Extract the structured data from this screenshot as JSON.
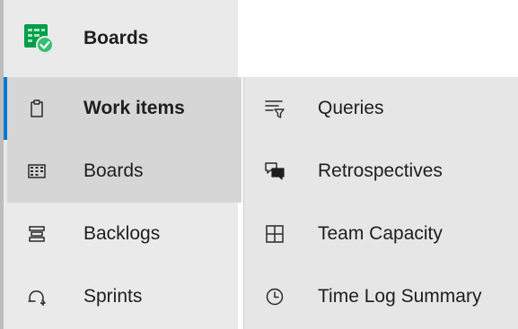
{
  "nav": {
    "header": {
      "label": "Boards",
      "icon": "boards-app-icon"
    },
    "items": [
      {
        "label": "Work items",
        "icon": "clipboard-icon",
        "state": "selected"
      },
      {
        "label": "Boards",
        "icon": "board-grid-icon",
        "state": "hovered"
      },
      {
        "label": "Backlogs",
        "icon": "backlog-icon",
        "state": "normal"
      },
      {
        "label": "Sprints",
        "icon": "sprint-icon",
        "state": "normal"
      }
    ]
  },
  "flyout": {
    "items": [
      {
        "label": "Queries",
        "icon": "filter-list-icon"
      },
      {
        "label": "Retrospectives",
        "icon": "chat-bubbles-icon"
      },
      {
        "label": "Team Capacity",
        "icon": "grid-icon"
      },
      {
        "label": "Time Log Summary",
        "icon": "clock-icon"
      }
    ]
  },
  "colors": {
    "accent": "#0078d4",
    "brand_green": "#009e49",
    "nav_bg": "#eaeaea",
    "selected_bg": "#d6d6d6",
    "flyout_bg": "#e6e6e6"
  }
}
